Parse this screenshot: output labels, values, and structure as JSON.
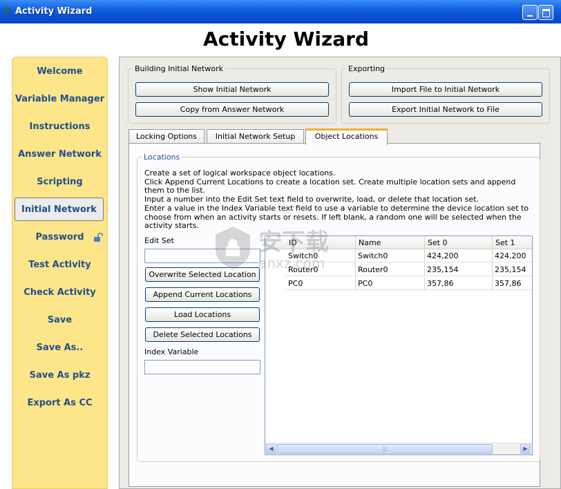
{
  "window": {
    "title": "Activity Wizard",
    "min": "_",
    "max": "□"
  },
  "heading": "Activity Wizard",
  "sidebar": {
    "items": [
      {
        "label": "Welcome"
      },
      {
        "label": "Variable Manager"
      },
      {
        "label": "Instructions"
      },
      {
        "label": "Answer Network"
      },
      {
        "label": "Scripting"
      },
      {
        "label": "Initial Network",
        "active": true
      },
      {
        "label": "Password"
      },
      {
        "label": "Test Activity"
      },
      {
        "label": "Check Activity"
      },
      {
        "label": "Save"
      },
      {
        "label": "Save As.."
      },
      {
        "label": "Save As pkz"
      },
      {
        "label": "Export As CC"
      }
    ]
  },
  "building": {
    "legend": "Building Initial Network",
    "show_btn": "Show Initial Network",
    "copy_btn": "Copy from Answer Network"
  },
  "exporting": {
    "legend": "Exporting",
    "import_btn": "Import File to Initial Network",
    "export_btn": "Export Initial Network to File"
  },
  "tabs": [
    "Locking Options",
    "Initial Network Setup",
    "Object Locations"
  ],
  "locations": {
    "legend": "Locations",
    "desc": [
      "Create a set of logical workspace object locations.",
      "Click Append Current Locations to create a location set. Create multiple location sets and append them to the list.",
      "Input a number into the Edit Set text field to overwrite, load, or delete that location set.",
      "Enter a value in the Index Variable text field to use a variable to determine the device location set to choose from when an activity starts or resets. If left blank, a random one will be selected when the activity starts."
    ],
    "edit_set_label": "Edit Set",
    "edit_set_value": "",
    "overwrite_btn": "Overwrite Selected Location",
    "append_btn": "Append Current Locations",
    "load_btn": "Load Locations",
    "delete_btn": "Delete Selected Locations",
    "index_var_label": "Index Variable",
    "index_var_value": ""
  },
  "table": {
    "headers": [
      "ID",
      "Name",
      "Set 0",
      "Set 1"
    ],
    "rows": [
      [
        "Switch0",
        "Switch0",
        "424,200",
        "424,200"
      ],
      [
        "Router0",
        "Router0",
        "235,154",
        "235,154"
      ],
      [
        "PC0",
        "PC0",
        "357,86",
        "357,86"
      ]
    ]
  },
  "scrollbar": {
    "left": "◀",
    "right": "▶",
    "grip": "|||"
  },
  "watermark": {
    "text": "安下载",
    "sub": "anxz.com"
  }
}
